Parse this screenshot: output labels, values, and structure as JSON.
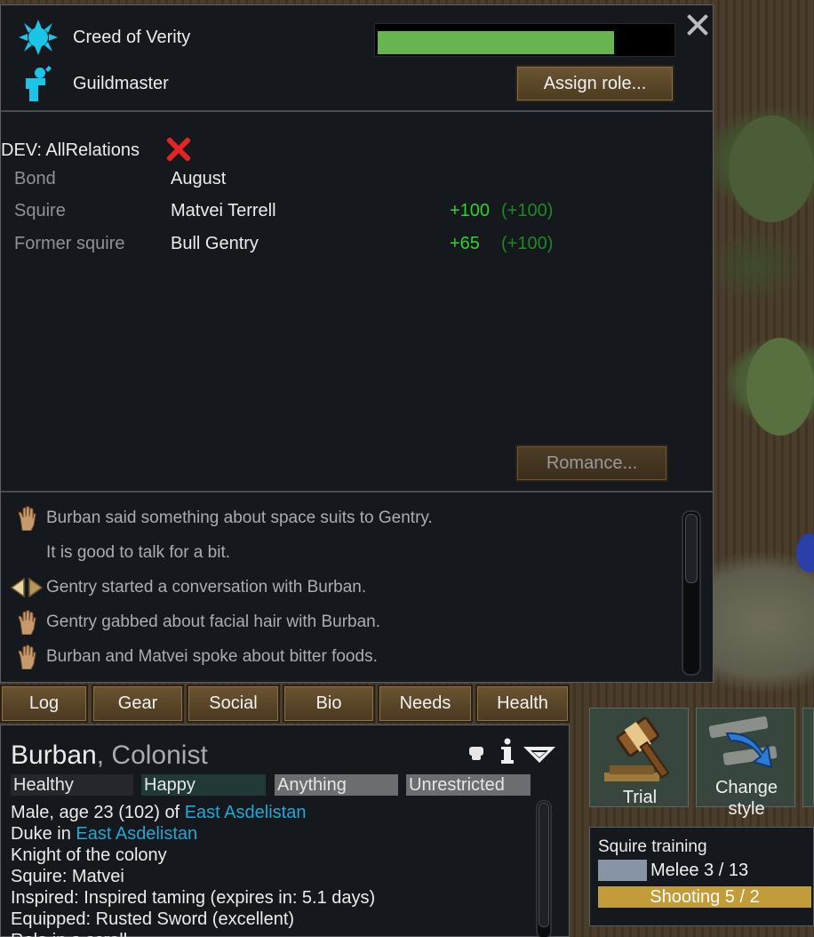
{
  "ideology": {
    "name": "Creed of Verity",
    "icon": "ideology-icon",
    "certainty": 0.8
  },
  "role": {
    "name": "Guildmaster",
    "icon": "guildmaster-icon"
  },
  "assign_role_label": "Assign role...",
  "dev_label": "DEV: AllRelations",
  "relations": [
    {
      "type": "Bond",
      "name": "August",
      "opinion": "",
      "base": ""
    },
    {
      "type": "Squire",
      "name": "Matvei Terrell",
      "opinion": "+100",
      "base": "(+100)"
    },
    {
      "type": "Former squire",
      "name": "Bull Gentry",
      "opinion": "+65",
      "base": "(+100)"
    }
  ],
  "romance_label": "Romance...",
  "log": [
    {
      "icon": "hand-icon",
      "text": "Burban said something about space suits to Gentry."
    },
    {
      "icon": "",
      "text": "It is good to talk for a bit."
    },
    {
      "icon": "conversation-icon",
      "text": "Gentry started a conversation with Burban."
    },
    {
      "icon": "hand-icon",
      "text": "Gentry gabbed about facial hair with Burban."
    },
    {
      "icon": "hand-icon",
      "text": "Burban and Matvei spoke about bitter foods."
    }
  ],
  "tabs": [
    "Log",
    "Gear",
    "Social",
    "Bio",
    "Needs",
    "Health"
  ],
  "pawn": {
    "name": "Burban",
    "kind": ", Colonist",
    "statuses": [
      "Healthy",
      "Happy",
      "Anything",
      "Unrestricted"
    ],
    "info": {
      "line1_pre": "Male, age 23 (102) of ",
      "faction": "East Asdelistan",
      "line2_pre": "Duke in ",
      "line2_link": "East Asdelistan",
      "line3": "Knight of the colony",
      "line4": "Squire: Matvei",
      "line5": "Inspired: Inspired taming (expires in: 5.1 days)",
      "line6": "Equipped: Rusted Sword (excellent)",
      "line7": "Role in a scroll"
    }
  },
  "gizmos": [
    {
      "label": "Trial",
      "icon": "gavel-icon"
    },
    {
      "label_line1": "Change",
      "label_line2": "style",
      "icon": "change-style-icon"
    }
  ],
  "squire": {
    "title": "Squire training",
    "melee": "Melee 3 / 13",
    "shooting": "Shooting 5 / 2"
  },
  "colors": {
    "positive": "#2ed32e",
    "link": "#22a7d6",
    "panel_bg": "#15181c",
    "certainty_bar": "#66b551"
  }
}
